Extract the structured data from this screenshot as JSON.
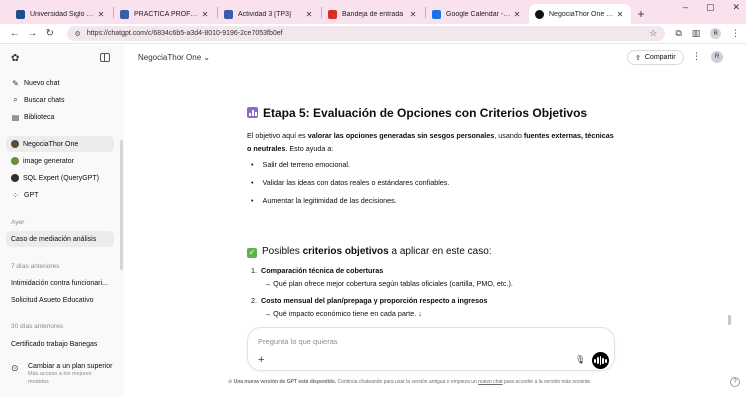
{
  "browser": {
    "tabs": [
      {
        "title": "Universidad Siglo 21 | Sig",
        "favicon_color": "#1f4e8c",
        "active": false
      },
      {
        "title": "PRÁCTICA PROFESIONAL (",
        "favicon_color": "#3a5da8",
        "active": false
      },
      {
        "title": "Actividad 3 [TP3]",
        "favicon_color": "#3a5da8",
        "active": false
      },
      {
        "title": "Bandeja de entrada",
        "favicon_color": "#d93025",
        "active": false
      },
      {
        "title": "Google Calendar - junio d",
        "favicon_color": "#1a73e8",
        "active": false
      },
      {
        "title": "NegociaThor One - Caso",
        "favicon_color": "#111111",
        "active": true
      }
    ],
    "new_tab": "+",
    "window_controls": [
      "–",
      "▢",
      "✕"
    ],
    "url": "https://chatgpt.com/c/6834c6b5-a3d4-8010-9196-2ce7053fb0ef",
    "profile_initial": "R"
  },
  "sidebar": {
    "logo_icon": "openai-logo-icon",
    "actions": [
      {
        "label": "Nuevo chat",
        "icon": "edit-icon"
      },
      {
        "label": "Buscar chats",
        "icon": "search-icon"
      },
      {
        "label": "Biblioteca",
        "icon": "library-icon"
      }
    ],
    "gpts": [
      {
        "label": "NegociaThor One",
        "avatar_color": "#5b4a3a",
        "selected": true
      },
      {
        "label": "image generator",
        "avatar_color": "#6a8f3c",
        "selected": false
      },
      {
        "label": "SQL Expert (QueryGPT)",
        "avatar_color": "#2f2f2f",
        "selected": false
      },
      {
        "label": "GPT",
        "icon": "grid-icon",
        "selected": false
      }
    ],
    "sections": [
      {
        "title": "Ayer",
        "items": [
          "Caso de mediación análisis"
        ]
      },
      {
        "title": "7 días anteriores",
        "items": [
          "Intimidación contra funcionari...",
          "Solicitud Asueto Educativo"
        ]
      },
      {
        "title": "30 días anteriores",
        "items": [
          "Certificado trabajo Banegas"
        ]
      }
    ],
    "selected_chat": "Caso de mediación análisis",
    "upgrade": {
      "title": "Cambiar a un plan superior",
      "subtitle_1": "Más acceso a los mejores",
      "subtitle_2": "modelos"
    }
  },
  "header": {
    "model_name": "NegociaThor One",
    "share_label": "Compartir",
    "user_initial": "R"
  },
  "message": {
    "heading": "Etapa 5: Evaluación de Opciones con Criterios Objetivos",
    "intro_a": "El objetivo aquí es ",
    "intro_b": "valorar las opciones generadas sin sesgos personales",
    "intro_c": ", usando ",
    "intro_d": "fuentes externas, técnicas",
    "intro_e": "o neutrales",
    "intro_f": ". Esto ayuda a:",
    "bullets": [
      "Salir del terreno emocional.",
      "Validar las ideas con datos reales o estándares confiables.",
      "Aumentar la legitimidad de las decisiones."
    ],
    "subheading_a": "Posibles ",
    "subheading_b": "criterios objetivos",
    "subheading_c": " a aplicar en este caso:",
    "criteria": [
      {
        "num": "1.",
        "title": "Comparación técnica de coberturas",
        "detail": "→ Qué plan ofrece mejor cobertura según tablas oficiales (cartilla, PMO, etc.)."
      },
      {
        "num": "2.",
        "title": "Costo mensual del plan/prepaga y proporción respecto a ingresos",
        "detail": "→ Qué impacto económico tiene en cada parte."
      }
    ],
    "scroll_down_icon": "arrow-down-icon"
  },
  "composer": {
    "placeholder": "Pregunta lo que quieras",
    "plus": "+",
    "mic_icon": "mic-icon",
    "voice_icon": "voice-mode-icon"
  },
  "footer": {
    "note_a": "Una nueva versión de GPT está disponible.",
    "note_b": " Continúa chateando para usar la versión antigua o empieza un ",
    "note_link": "nuevo chat",
    "note_c": " para acceder a la versión más reciente.",
    "help": "?"
  }
}
